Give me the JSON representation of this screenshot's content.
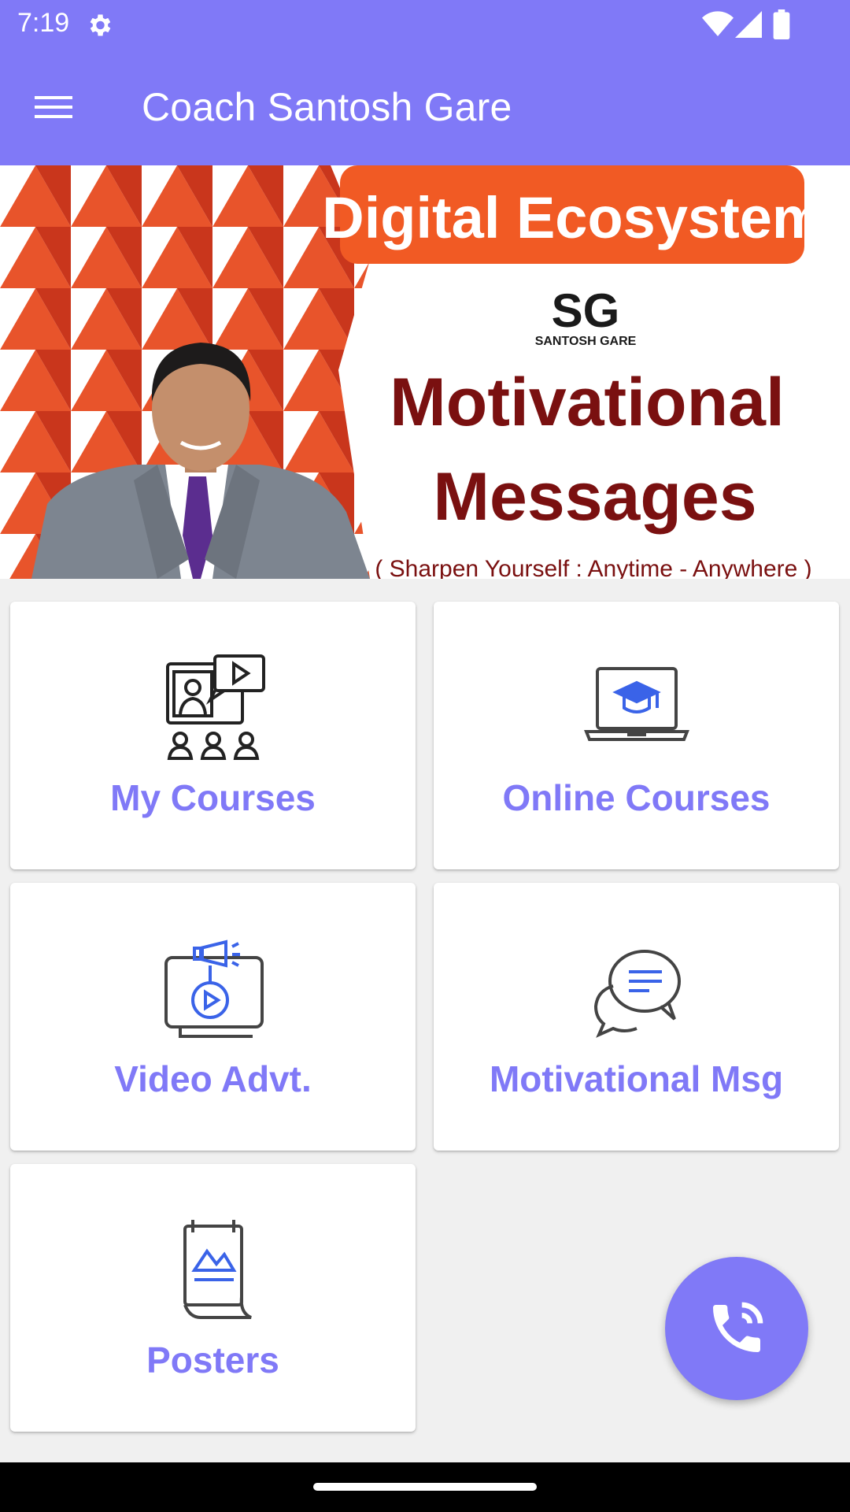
{
  "status_bar": {
    "time": "7:19",
    "icons": [
      "gear-icon",
      "wifi-icon",
      "signal-icon",
      "battery-icon"
    ]
  },
  "app_bar": {
    "title": "Coach Santosh Gare",
    "menu_icon": "hamburger-menu-icon"
  },
  "banner": {
    "headline": "Digital Ecosystem",
    "logo_text": "SG",
    "logo_subtext": "SANTOSH GARE",
    "title_line1": "Motivational",
    "title_line2": "Messages",
    "tagline": "( Sharpen Yourself : Anytime - Anywhere )"
  },
  "menu_cards": [
    {
      "label": "My Courses",
      "icon": "video-class-icon"
    },
    {
      "label": "Online Courses",
      "icon": "laptop-graduation-icon"
    },
    {
      "label": "Video Advt.",
      "icon": "video-megaphone-icon"
    },
    {
      "label": "Motivational Msg",
      "icon": "chat-bubbles-icon"
    },
    {
      "label": "Posters",
      "icon": "poster-icon"
    }
  ],
  "fab": {
    "icon": "phone-call-icon"
  },
  "colors": {
    "primary": "#8079f7",
    "background": "#f0f0f0",
    "banner_orange": "#f15a24",
    "banner_maroon": "#7a1010",
    "icon_blue": "#3a63e8",
    "icon_dark": "#333333"
  }
}
